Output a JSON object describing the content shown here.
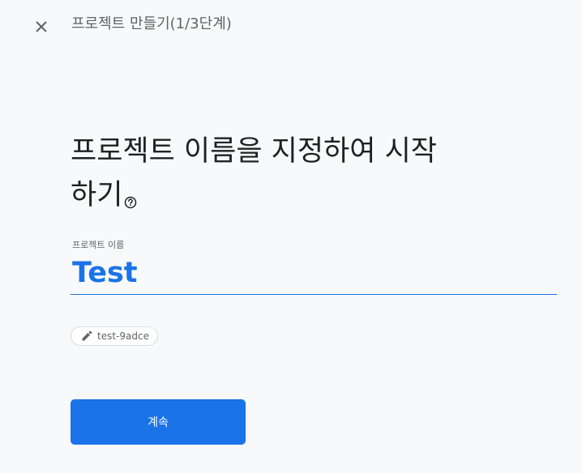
{
  "header": {
    "close_icon": "close-icon",
    "step_title": "프로젝트 만들기(1/3단계)"
  },
  "main": {
    "heading": "프로젝트 이름을 지정하여 시작하기",
    "help_icon": "help-circle-icon"
  },
  "form": {
    "project_name_label": "프로젝트 이름",
    "project_name_value": "Test",
    "project_id_icon": "pencil-icon",
    "project_id": "test-9adce"
  },
  "actions": {
    "continue_label": "계속"
  },
  "colors": {
    "accent": "#1a73e8",
    "background": "#f8f9fa",
    "text_primary": "#202124",
    "text_secondary": "#5f6368"
  }
}
